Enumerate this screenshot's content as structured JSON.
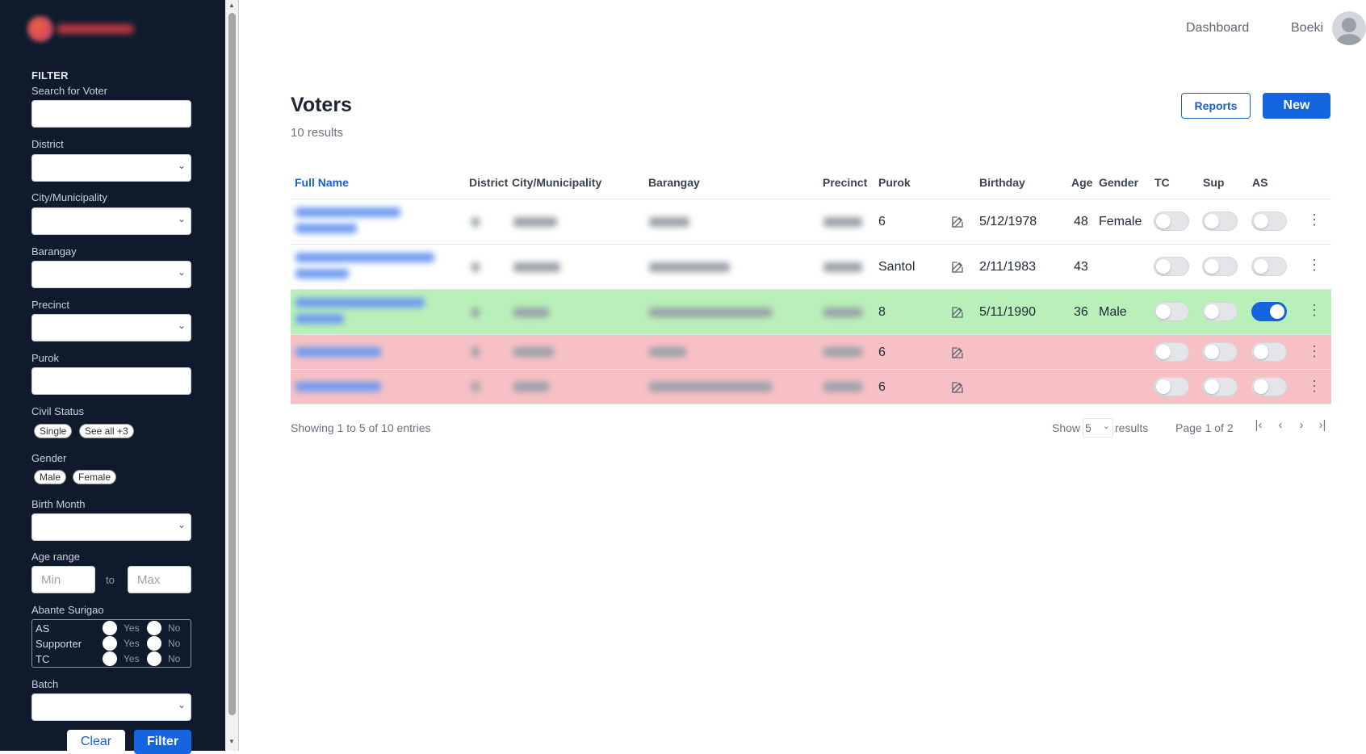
{
  "sidebar": {
    "filter_title": "FILTER",
    "search_label": "Search for Voter",
    "district_label": "District",
    "city_label": "City/Municipality",
    "barangay_label": "Barangay",
    "precinct_label": "Precinct",
    "purok_label": "Purok",
    "civil_status_label": "Civil Status",
    "civil_status_chips": [
      "Single",
      "See all +3"
    ],
    "gender_label": "Gender",
    "gender_chips": [
      "Male",
      "Female"
    ],
    "birth_month_label": "Birth Month",
    "age_range_label": "Age range",
    "age_min_placeholder": "Min",
    "age_max_placeholder": "Max",
    "age_to": "to",
    "abante_label": "Abante Surigao",
    "abante_rows": [
      {
        "name": "AS",
        "yes": "Yes",
        "no": "No"
      },
      {
        "name": "Supporter",
        "yes": "Yes",
        "no": "No"
      },
      {
        "name": "TC",
        "yes": "Yes",
        "no": "No"
      }
    ],
    "batch_label": "Batch",
    "clear_label": "Clear",
    "filter_label": "Filter"
  },
  "topnav": {
    "dashboard": "Dashboard",
    "user": "Boeki"
  },
  "main": {
    "title": "Voters",
    "subtitle": "10 results",
    "reports_label": "Reports",
    "new_label": "New"
  },
  "table": {
    "headers": {
      "full_name": "Full Name",
      "district": "District",
      "city": "City/Municipality",
      "barangay": "Barangay",
      "precinct": "Precinct",
      "purok": "Purok",
      "birthday": "Birthday",
      "age": "Age",
      "gender": "Gender",
      "tc": "TC",
      "sup": "Sup",
      "as": "AS"
    },
    "rows": [
      {
        "purok": "6",
        "birthday": "5/12/1978",
        "age": "48",
        "gender": "Female",
        "tc": false,
        "sup": false,
        "as": false,
        "status": "normal"
      },
      {
        "purok": "Santol",
        "birthday": "2/11/1983",
        "age": "43",
        "gender": "",
        "tc": false,
        "sup": false,
        "as": false,
        "status": "normal"
      },
      {
        "purok": "8",
        "birthday": "5/11/1990",
        "age": "36",
        "gender": "Male",
        "tc": false,
        "sup": false,
        "as": true,
        "status": "green"
      },
      {
        "purok": "6",
        "birthday": "",
        "age": "",
        "gender": "",
        "tc": false,
        "sup": false,
        "as": false,
        "status": "red"
      },
      {
        "purok": "6",
        "birthday": "",
        "age": "",
        "gender": "",
        "tc": false,
        "sup": false,
        "as": false,
        "status": "red"
      }
    ]
  },
  "footer": {
    "showing": "Showing 1 to 5 of 10 entries",
    "show_label": "Show",
    "show_value": "5",
    "results_label": "results",
    "page_label": "Page 1 of 2"
  },
  "colors": {
    "sidebar_bg": "#0f1b2d",
    "primary": "#1565e0",
    "row_green": "#b9f0b9",
    "row_red": "#f6c0c4"
  }
}
